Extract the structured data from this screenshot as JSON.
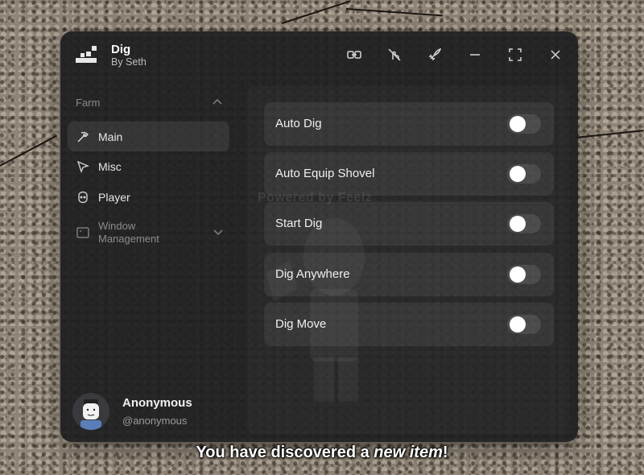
{
  "app": {
    "title": "Dig",
    "subtitle": "By Seth"
  },
  "titlebar": {
    "icons": [
      "link-icon",
      "no-touch-icon",
      "rocket-icon",
      "minimize-icon",
      "fullscreen-icon",
      "close-icon"
    ]
  },
  "sidebar": {
    "section": "Farm",
    "items": [
      {
        "label": "Main",
        "icon": "pickaxe-icon",
        "active": true
      },
      {
        "label": "Misc",
        "icon": "cursor-icon",
        "active": false
      },
      {
        "label": "Player",
        "icon": "user-face-icon",
        "active": false
      },
      {
        "label": "Window Management",
        "icon": "window-icon",
        "active": false
      }
    ]
  },
  "main": {
    "toggles": [
      {
        "label": "Auto Dig",
        "on": false
      },
      {
        "label": "Auto Equip Shovel",
        "on": false
      },
      {
        "label": "Start Dig",
        "on": false
      },
      {
        "label": "Dig Anywhere",
        "on": false
      },
      {
        "label": "Dig Move",
        "on": false
      }
    ]
  },
  "watermark": "Powered by Feelz",
  "user": {
    "name": "Anonymous",
    "handle": "@anonymous"
  },
  "notification": {
    "prefix": "You have discovered a ",
    "highlight": "new item",
    "suffix": "!"
  },
  "colors": {
    "window_bg": "#1e1e20",
    "knob": "#ffffff",
    "text": "#f0f0f0"
  }
}
